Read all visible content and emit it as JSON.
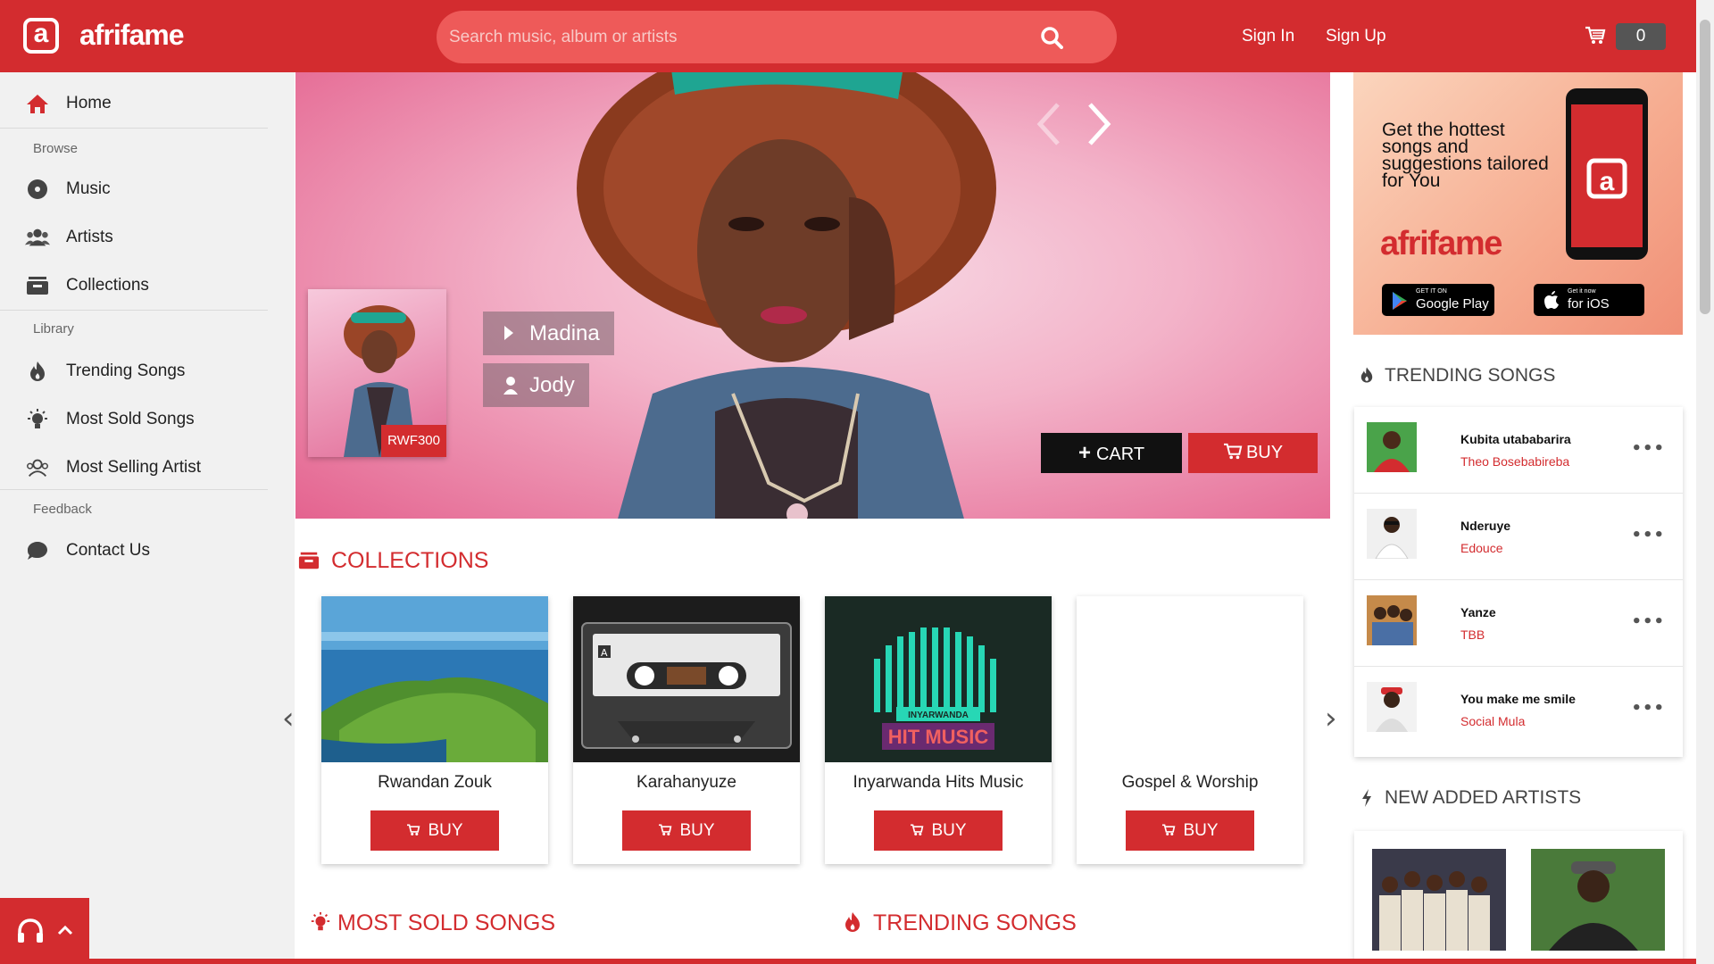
{
  "header": {
    "brand": "afrifame",
    "search_placeholder": "Search music, album or artists",
    "sign_in": "Sign In",
    "sign_up": "Sign Up",
    "cart_count": "0"
  },
  "sidebar": {
    "home": "Home",
    "browse_heading": "Browse",
    "browse_items": [
      "Music",
      "Artists",
      "Collections"
    ],
    "library_heading": "Library",
    "library_items": [
      "Trending Songs",
      "Most Sold Songs",
      "Most Selling Artist"
    ],
    "feedback_heading": "Feedback",
    "contact": "Contact Us"
  },
  "hero": {
    "song": "Madina",
    "artist": "Jody",
    "price": "RWF300",
    "cart_label": "CART",
    "buy_label": "BUY"
  },
  "collections": {
    "title": "COLLECTIONS",
    "items": [
      {
        "title": "Rwandan Zouk",
        "buy": "BUY"
      },
      {
        "title": "Karahanyuze",
        "buy": "BUY"
      },
      {
        "title": "Inyarwanda Hits Music",
        "buy": "BUY"
      },
      {
        "title": "Gospel & Worship",
        "buy": "BUY"
      }
    ],
    "art_texts": {
      "cassette_letter": "A",
      "inyarwanda": "INYARWANDA",
      "hit_music": "HIT MUSIC"
    }
  },
  "bottom_sections": {
    "most_sold": "MOST SOLD SONGS",
    "trending": "TRENDING SONGS"
  },
  "promo": {
    "tagline": "Get the hottest songs and suggestions tailored for You",
    "brand": "afrifame",
    "google_small": "GET IT ON",
    "google_big": "Google Play",
    "ios_small": "Get it now",
    "ios_big": "for iOS"
  },
  "trending": {
    "title": "TRENDING SONGS",
    "items": [
      {
        "song": "Kubita utababarira",
        "artist": "Theo Bosebabireba"
      },
      {
        "song": "Nderuye",
        "artist": "Edouce"
      },
      {
        "song": "Yanze",
        "artist": "TBB"
      },
      {
        "song": "You make me smile",
        "artist": "Social Mula"
      }
    ]
  },
  "new_artists": {
    "title": "NEW ADDED ARTISTS"
  },
  "colors": {
    "brand": "#d32c2f",
    "sidebar": "#f1f1f1"
  }
}
